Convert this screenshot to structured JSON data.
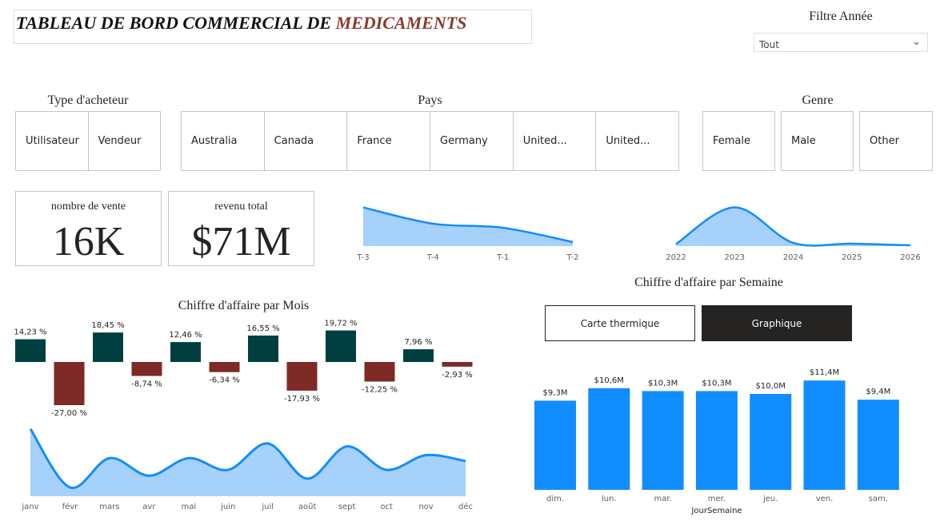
{
  "header": {
    "title_main": "TABLEAU DE BORD COMMERCIAL DE ",
    "title_accent": "MEDICAMENTS"
  },
  "year_filter": {
    "label": "Filtre Année",
    "value": "Tout"
  },
  "buyer_type": {
    "title": "Type d'acheteur",
    "items": [
      "Utilisateur",
      "Vendeur"
    ]
  },
  "country": {
    "title": "Pays",
    "items": [
      "Australia",
      "Canada",
      "France",
      "Germany",
      "United...",
      "United..."
    ]
  },
  "gender": {
    "title": "Genre",
    "items": [
      "Female",
      "Male",
      "Other"
    ]
  },
  "kpi": {
    "sales_count": {
      "label": "nombre de vente",
      "value": "16K"
    },
    "revenue": {
      "label": "revenu total",
      "value": "$71M"
    }
  },
  "monthly": {
    "title": "Chiffre d'affaire par Mois"
  },
  "weekly": {
    "title": "Chiffre d'affaire par Semaine",
    "toggle_heatmap": "Carte thermique",
    "toggle_chart": "Graphique"
  },
  "colors": {
    "blue": "#118dff",
    "area_fill": "#a6d1fb",
    "pos_bar": "#003f3f",
    "neg_bar": "#7e2a26",
    "title_accent": "#8a3a2e",
    "toggle_dark": "#252423"
  },
  "chart_data": [
    {
      "id": "quarter_trend",
      "type": "area",
      "x": [
        "T-3",
        "T-4",
        "T-1",
        "T-2"
      ],
      "values": [
        0.95,
        0.55,
        0.45,
        0.1
      ]
    },
    {
      "id": "year_trend",
      "type": "area",
      "x": [
        "2022",
        "2023",
        "2024",
        "2025",
        "2026"
      ],
      "values": [
        0.05,
        0.95,
        0.08,
        0.06,
        0.02
      ]
    },
    {
      "id": "monthly_growth",
      "type": "bar",
      "categories": [
        "janv",
        "févr",
        "mars",
        "avr",
        "mai",
        "juin",
        "juil",
        "août",
        "sept",
        "oct",
        "nov",
        "déc"
      ],
      "values": [
        14.23,
        -27.0,
        18.45,
        -8.74,
        12.46,
        -6.34,
        16.55,
        -17.93,
        19.72,
        -12.25,
        7.96,
        -2.93
      ],
      "labels": [
        "14,23 %",
        "-27,00 %",
        "18,45 %",
        "-8,74 %",
        "12,46 %",
        "-6,34 %",
        "16,55 %",
        "-17,93 %",
        "19,72 %",
        "-12,25 %",
        "7,96 %",
        "-2,93 %"
      ]
    },
    {
      "id": "monthly_revenue",
      "type": "area",
      "categories": [
        "janv",
        "févr",
        "mars",
        "avr",
        "mai",
        "juin",
        "juil",
        "août",
        "sept",
        "oct",
        "nov",
        "déc"
      ],
      "values": [
        7.3,
        5.3,
        6.3,
        5.7,
        6.3,
        5.9,
        6.8,
        5.6,
        6.7,
        5.9,
        6.4,
        6.2
      ]
    },
    {
      "id": "weekly_revenue",
      "type": "bar",
      "categories": [
        "dim.",
        "lun.",
        "mar.",
        "mer.",
        "jeu.",
        "ven.",
        "sam."
      ],
      "values": [
        9.3,
        10.6,
        10.3,
        10.3,
        10.0,
        11.4,
        9.4
      ],
      "labels": [
        "$9,3M",
        "$10,6M",
        "$10,3M",
        "$10,3M",
        "$10,0M",
        "$11,4M",
        "$9,4M"
      ],
      "xlabel": "JourSemaine"
    }
  ]
}
